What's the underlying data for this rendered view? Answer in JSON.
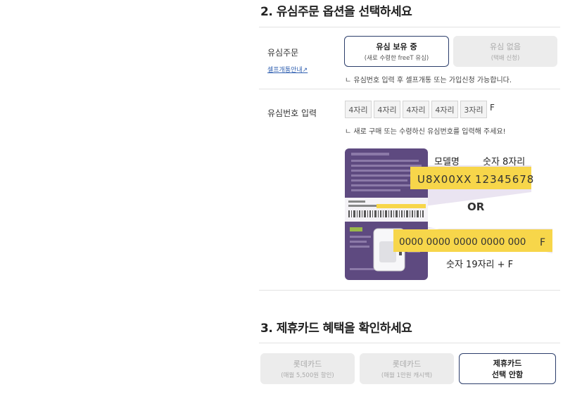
{
  "section2": {
    "title": "2. 유심주문 옵션을 선택하세요",
    "usim_order_label": "유심주문",
    "self_open_link": "셀프개통안내↗",
    "options": [
      {
        "main": "유심 보유 중",
        "sub": "(새로 수령한 freeT 유심)"
      },
      {
        "main": "유심 없음",
        "sub": "(택배 신청)"
      }
    ],
    "option_note": "ㄴ 유심번호 입력 후 셀프개통 또는 가입신청 가능합니다.",
    "usim_number_label": "유심번호 입력",
    "digit_fields": [
      "4자리",
      "4자리",
      "4자리",
      "4자리",
      "3자리"
    ],
    "digit_suffix": "F",
    "digit_note": "ㄴ 새로 구매 또는 수령하신 유심번호를 입력해 주세요!",
    "illustration": {
      "model_label": "모델명",
      "digits8_label": "숫자 8자리",
      "model_value": "U8X00XX",
      "serial_value": "12345678",
      "or_label": "OR",
      "long_number": "0000 0000 0000 0000 000",
      "long_suffix": "F",
      "digits19_label": "숫자 19자리 + F",
      "card_brand": "freeT"
    }
  },
  "section3": {
    "title": "3. 제휴카드 혜택을 확인하세요",
    "options": [
      {
        "main": "롯데카드",
        "sub": "(매월 5,500원 할인)"
      },
      {
        "main": "롯데카드",
        "sub": "(매월 1만원 캐시백)"
      },
      {
        "main": "제휴카드",
        "sub": "선택 안함"
      }
    ]
  },
  "colors": {
    "accent_border": "#2c3e6b",
    "card_purple": "#5e4a80",
    "highlight_yellow": "#f7d64a",
    "link_blue": "#2f5fb0"
  }
}
